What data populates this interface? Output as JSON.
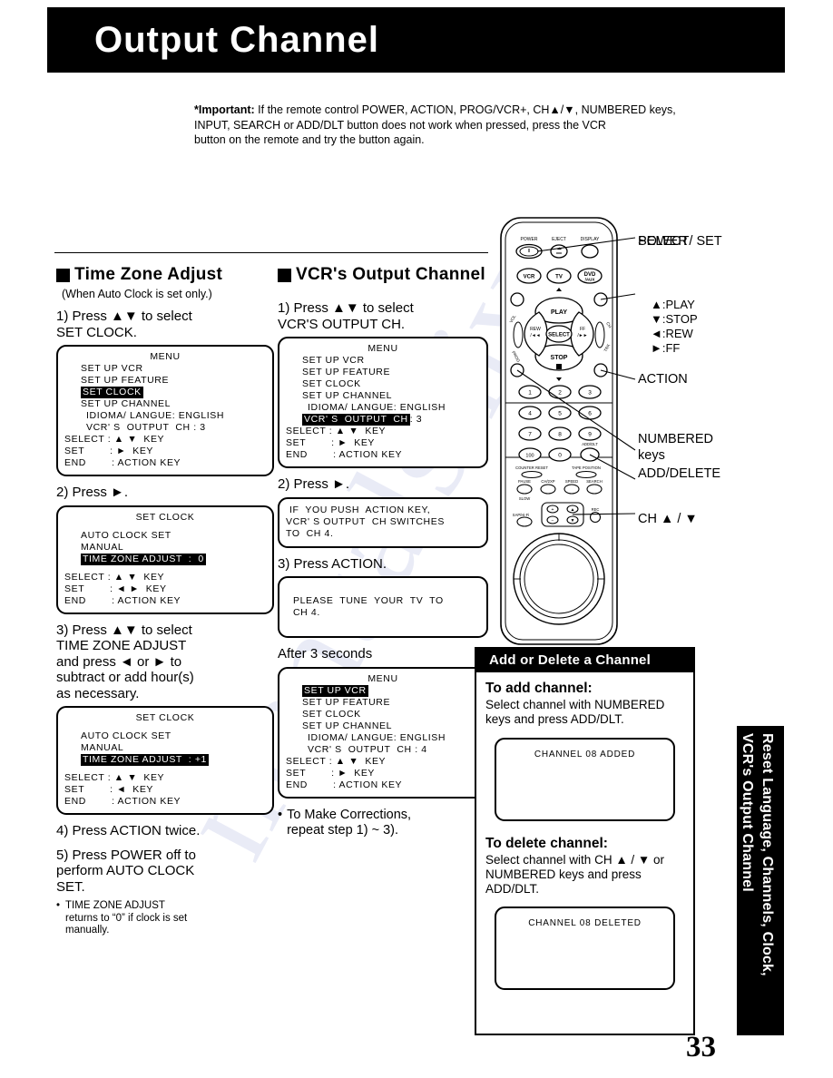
{
  "header": {
    "title": "Output Channel"
  },
  "important": {
    "label": "*Important:",
    "line1": "If the remote control POWER, ACTION, PROG/VCR+, CH▲/▼, NUMBERED keys,",
    "line2": "INPUT, SEARCH or ADD/DLT button does not work when pressed, press the VCR",
    "line3": "button on the remote and try the button again."
  },
  "left_column": {
    "heading": "Time Zone Adjust",
    "subnote": "(When Auto Clock is set only.)",
    "step1": "1) Press ▲▼ to select\n     SET CLOCK.",
    "menu1": {
      "title": "MENU",
      "r1": "SET UP VCR",
      "r2": "SET UP FEATURE",
      "r3": "SET CLOCK",
      "r4": "SET UP CHANNEL",
      "r5": "IDIOMA/ LANGUE: ENGLISH",
      "r6": "VCR' S  OUTPUT  CH : 3",
      "f1": "SELECT : ▲ ▼  KEY",
      "f2": "SET        : ►  KEY",
      "f3": "END        : ACTION KEY"
    },
    "step2": "2) Press ►.",
    "menu2": {
      "title": "SET CLOCK",
      "r1": "AUTO CLOCK SET",
      "r2": "MANUAL",
      "r3": "TIME ZONE ADJUST  :  0",
      "f1": "SELECT : ▲ ▼  KEY",
      "f2": "SET        : ◄ ►  KEY",
      "f3": "END        : ACTION KEY"
    },
    "step3": "3) Press ▲▼ to select\n     TIME ZONE ADJUST\n     and press ◄ or ► to\n     subtract or add hour(s)\n     as necessary.",
    "menu3": {
      "title": "SET CLOCK",
      "r1": "AUTO CLOCK SET",
      "r2": "MANUAL",
      "r3": "TIME ZONE ADJUST  : +1",
      "f1": "SELECT : ▲ ▼  KEY",
      "f2": "SET        : ◄  KEY",
      "f3": "END        : ACTION KEY"
    },
    "step4": "4) Press ACTION twice.",
    "step5": "5) Press POWER off to\n     perform AUTO CLOCK\n     SET.",
    "note_dot": "•",
    "note": "TIME ZONE ADJUST\nreturns to “0” if clock is set\nmanually."
  },
  "mid_column": {
    "heading": "VCR's Output Channel",
    "step1": "1) Press ▲▼ to select\n     VCR'S OUTPUT CH.",
    "menu1": {
      "title": "MENU",
      "r1": "SET UP VCR",
      "r2": "SET UP FEATURE",
      "r3": "SET CLOCK",
      "r4": "SET UP CHANNEL",
      "r5": "IDIOMA/ LANGUE: ENGLISH",
      "r6": "VCR' S  OUTPUT  CH",
      "r6v": ": 3",
      "f1": "SELECT : ▲ ▼  KEY",
      "f2": "SET        : ►  KEY",
      "f3": "END        : ACTION KEY"
    },
    "step2": "2) Press ►.",
    "msg1_l1": "IF  YOU PUSH  ACTION KEY,",
    "msg1_l2": "VCR' S OUTPUT  CH SWITCHES",
    "msg1_l3": "TO  CH 4.",
    "step3": "3) Press ACTION.",
    "msg2_l1": "PLEASE  TUNE  YOUR  TV  TO",
    "msg2_l2": "CH 4.",
    "after": "After 3 seconds",
    "menu2": {
      "title": "MENU",
      "r1": "SET UP VCR",
      "r2": "SET UP FEATURE",
      "r3": "SET CLOCK",
      "r4": "SET UP CHANNEL",
      "r5": "IDIOMA/ LANGUE: ENGLISH",
      "r6": "VCR' S  OUTPUT  CH : 4",
      "f1": "SELECT : ▲ ▼  KEY",
      "f2": "SET        : ►  KEY",
      "f3": "END        : ACTION KEY"
    },
    "bullet_dot": "•",
    "bullet": "To Make Corrections,\nrepeat step 1) ~ 3)."
  },
  "remote": {
    "top_row": [
      "POWER",
      "EJECT",
      "DISPLAY"
    ],
    "mode_row": [
      "VCR",
      "TV",
      "DVD/AUX"
    ],
    "dpad": {
      "up": "PLAY",
      "down": "STOP",
      "left": "REW",
      "right": "FF",
      "center": "SELECT"
    },
    "side_left": [
      "VOL",
      "CH"
    ],
    "side_right": [
      "VOL",
      "CH"
    ],
    "numbers": [
      "1",
      "2",
      "3",
      "4",
      "5",
      "6",
      "7",
      "8",
      "9",
      "100",
      "0"
    ],
    "add_dlt": "ADD/DLT",
    "labels_row": [
      "COUNTER RESET",
      "TAPE POSITION"
    ],
    "fn_row": [
      "PAUSE",
      "CH/2XP",
      "SPEED",
      "SEARCH"
    ],
    "slow": "SLOW",
    "sap": "SAP/Hi-Fi",
    "rec": "REC",
    "prog_vcr": "PROG/VCR+",
    "tracking": "TRACKING"
  },
  "remote_labels": {
    "power": "POWER",
    "select_set": "SELECT/ SET",
    "play": "▲:PLAY",
    "stop": "▼:STOP",
    "rew": "◄:REW",
    "ff": "►:FF",
    "action": "ACTION",
    "numbered1": "NUMBERED",
    "numbered2": "keys",
    "add_delete": "ADD/DELETE",
    "ch": "CH ▲ / ▼"
  },
  "add_delete_box": {
    "title": "Add or Delete a Channel",
    "add_heading": "To add channel:",
    "add_text": "Select channel with NUMBERED keys and press ADD/DLT.",
    "add_screen": "CHANNEL  08  ADDED",
    "del_heading": "To delete channel:",
    "del_text": "Select channel with CH ▲ / ▼ or NUMBERED keys and press ADD/DLT.",
    "del_screen": "CHANNEL  08  DELETED"
  },
  "side_tab": {
    "line1": "Reset Language, Channels, Clock,",
    "line2": "VCR's Output Channel"
  },
  "page_number": "33",
  "watermark": {
    "text": "manualshiv"
  }
}
